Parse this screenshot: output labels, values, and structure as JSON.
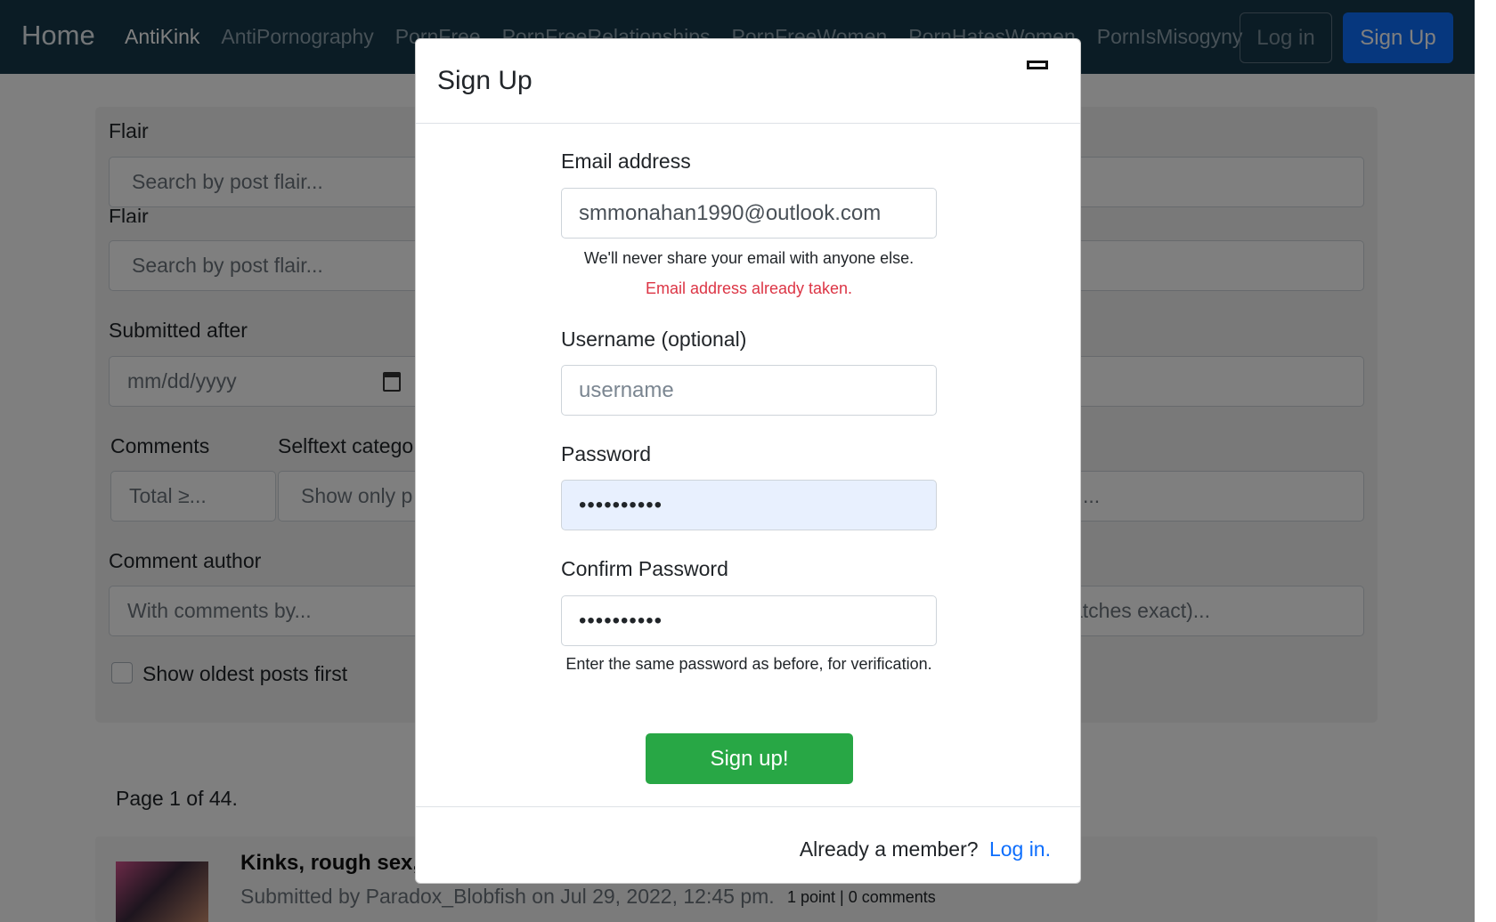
{
  "navbar": {
    "brand": "Home",
    "links": [
      "AntiKink",
      "AntiPornography",
      "PornFree",
      "PornFreeRelationships",
      "PornFreeWomen",
      "PornHatesWomen",
      "PornIsMisogyny"
    ],
    "login_label": "Log in",
    "signup_label": "Sign Up"
  },
  "search_form": {
    "flair_label": "Flair",
    "flair_label_2": "Flair",
    "flair_placeholder": "Search by post flair...",
    "submitted_after_label": "Submitted after",
    "date_placeholder": "mm/dd/yyyy",
    "comments_label": "Comments",
    "comments_placeholder": "Total ≥...",
    "selftext_label": "Selftext catego",
    "selftext_value": "Show only p",
    "right_fragment_1": "...",
    "comment_author_label": "Comment author",
    "comment_author_placeholder": "With comments by...",
    "right_fragment_2": "atches exact)...",
    "oldest_first_label": "Show oldest posts first"
  },
  "results": {
    "page_count": "Page 1 of 44.",
    "post": {
      "title": "Kinks, rough sex,",
      "meta": "Submitted by Paradox_Blobfish on Jul 29, 2022, 12:45 pm.",
      "stats": "1 point | 0 comments"
    }
  },
  "modal": {
    "title": "Sign Up",
    "email_label": "Email address",
    "email_value": "smmonahan1990@outlook.com",
    "email_help": "We'll never share your email with anyone else.",
    "email_error": "Email address already taken.",
    "username_label": "Username (optional)",
    "username_placeholder": "username",
    "password_label": "Password",
    "password_dots": "••••••••••",
    "confirm_label": "Confirm Password",
    "confirm_dots": "••••••••••",
    "confirm_help": "Enter the same password as before, for verification.",
    "submit_label": "Sign up!",
    "footer_text": "Already a member?",
    "footer_link": "Log in."
  }
}
